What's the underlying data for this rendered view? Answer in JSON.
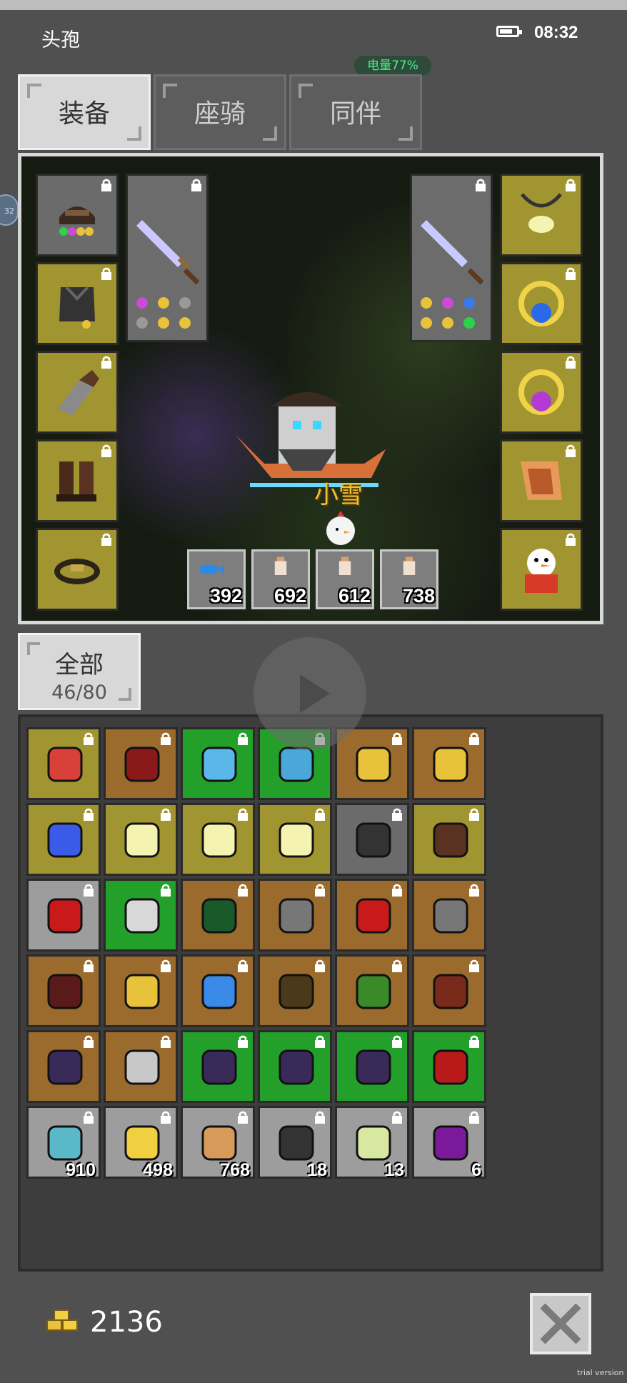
{
  "header": {
    "title": "头孢",
    "clock": "08:32",
    "power": "电量77%",
    "side_badge": "32",
    "battery_level": 0.77
  },
  "tabs": [
    {
      "label": "装备"
    },
    {
      "label": "座骑"
    },
    {
      "label": "同伴"
    }
  ],
  "scene": {
    "player_name": "小雪",
    "consumables": [
      {
        "icon": "blue-fish-icon",
        "qty": "392"
      },
      {
        "icon": "potion-icon",
        "qty": "692"
      },
      {
        "icon": "potion-icon",
        "qty": "612"
      },
      {
        "icon": "potion-icon",
        "qty": "738"
      }
    ]
  },
  "inventory": {
    "filter_label": "全部",
    "count": "46/80",
    "rows": [
      [
        "gold",
        "brown",
        "green",
        "green",
        "brown",
        "brown"
      ],
      [
        "gold",
        "gold",
        "gold",
        "gold",
        "darkgrey",
        "gold"
      ],
      [
        "grey",
        "green",
        "brown",
        "brown",
        "brown",
        "brown"
      ],
      [
        "brown",
        "brown",
        "brown",
        "brown",
        "brown",
        "brown"
      ],
      [
        "brown",
        "brown",
        "green",
        "green",
        "green",
        "green"
      ],
      [
        "grey",
        "grey",
        "grey",
        "grey",
        "grey",
        "grey"
      ]
    ],
    "last_row_qty": [
      "910",
      "498",
      "768",
      "18",
      "13",
      "6"
    ]
  },
  "footer": {
    "gold_amount": "2136",
    "watermark": "trial version"
  },
  "colors": {
    "gold": "#a19531",
    "brown": "#9a6b2c",
    "green": "#22a02a",
    "grey": "#9d9d9d",
    "darkgrey": "#6b6b6b"
  }
}
